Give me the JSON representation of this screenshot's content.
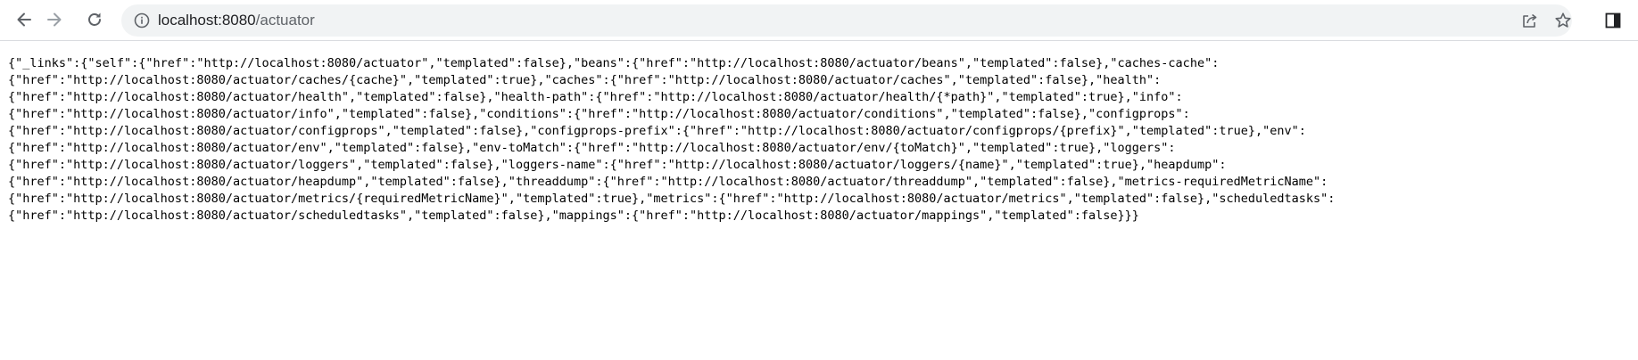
{
  "browser": {
    "url_host": "localhost:8080",
    "url_path": "/actuator",
    "icons": {
      "back": "arrow-left-icon",
      "forward": "arrow-right-icon",
      "reload": "reload-icon",
      "site_info": "info-icon",
      "share": "share-icon",
      "bookmark": "star-icon",
      "side_panel": "side-panel-icon"
    },
    "colors": {
      "toolbar_bg": "#ffffff",
      "omnibox_bg": "#f1f3f4",
      "icon": "#5f6368",
      "forward_disabled": "#9aa0a6"
    }
  },
  "page": {
    "lines": [
      "{\"_links\":{\"self\":{\"href\":\"http://localhost:8080/actuator\",\"templated\":false},\"beans\":{\"href\":\"http://localhost:8080/actuator/beans\",\"templated\":false},\"caches-cache\":",
      "{\"href\":\"http://localhost:8080/actuator/caches/{cache}\",\"templated\":true},\"caches\":{\"href\":\"http://localhost:8080/actuator/caches\",\"templated\":false},\"health\":",
      "{\"href\":\"http://localhost:8080/actuator/health\",\"templated\":false},\"health-path\":{\"href\":\"http://localhost:8080/actuator/health/{*path}\",\"templated\":true},\"info\":",
      "{\"href\":\"http://localhost:8080/actuator/info\",\"templated\":false},\"conditions\":{\"href\":\"http://localhost:8080/actuator/conditions\",\"templated\":false},\"configprops\":",
      "{\"href\":\"http://localhost:8080/actuator/configprops\",\"templated\":false},\"configprops-prefix\":{\"href\":\"http://localhost:8080/actuator/configprops/{prefix}\",\"templated\":true},\"env\":",
      "{\"href\":\"http://localhost:8080/actuator/env\",\"templated\":false},\"env-toMatch\":{\"href\":\"http://localhost:8080/actuator/env/{toMatch}\",\"templated\":true},\"loggers\":",
      "{\"href\":\"http://localhost:8080/actuator/loggers\",\"templated\":false},\"loggers-name\":{\"href\":\"http://localhost:8080/actuator/loggers/{name}\",\"templated\":true},\"heapdump\":",
      "{\"href\":\"http://localhost:8080/actuator/heapdump\",\"templated\":false},\"threaddump\":{\"href\":\"http://localhost:8080/actuator/threaddump\",\"templated\":false},\"metrics-requiredMetricName\":",
      "{\"href\":\"http://localhost:8080/actuator/metrics/{requiredMetricName}\",\"templated\":true},\"metrics\":{\"href\":\"http://localhost:8080/actuator/metrics\",\"templated\":false},\"scheduledtasks\":",
      "{\"href\":\"http://localhost:8080/actuator/scheduledtasks\",\"templated\":false},\"mappings\":{\"href\":\"http://localhost:8080/actuator/mappings\",\"templated\":false}}}"
    ]
  }
}
